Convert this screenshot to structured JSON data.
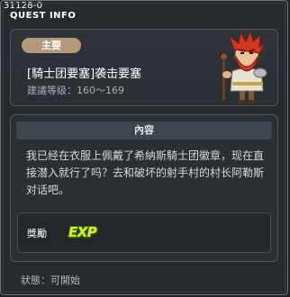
{
  "window": {
    "quest_id": "31128-0",
    "title": "QUEST INFO"
  },
  "quest": {
    "type_badge": "主要",
    "name": "[騎士团要塞]袭击要塞",
    "level": "建議等级：160～169",
    "npc_icon": "red-bearded-warrior-npc"
  },
  "content": {
    "header": "內容",
    "text": "我已经在衣服上佩戴了希納斯騎士团徽章，现在直接潜入就行了吗？去和破坏的射手村的村长阿勒斯对话吧。"
  },
  "reward": {
    "label": "獎勵",
    "exp_icon_text": "EXP"
  },
  "status": "狀態：可開始"
}
